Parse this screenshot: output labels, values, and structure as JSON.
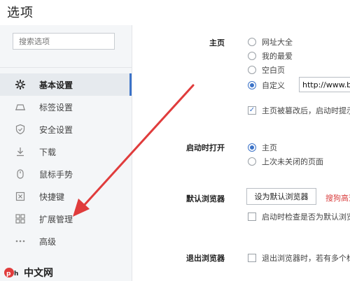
{
  "window": {
    "title": "选项"
  },
  "search": {
    "placeholder": "搜索选项"
  },
  "sidebar": {
    "items": [
      {
        "label": "基本设置",
        "icon": "gear-icon",
        "active": true
      },
      {
        "label": "标签设置",
        "icon": "tab-icon",
        "active": false
      },
      {
        "label": "安全设置",
        "icon": "shield-icon",
        "active": false
      },
      {
        "label": "下载",
        "icon": "download-icon",
        "active": false
      },
      {
        "label": "鼠标手势",
        "icon": "mouse-icon",
        "active": false
      },
      {
        "label": "快捷键",
        "icon": "shortcut-icon",
        "active": false
      },
      {
        "label": "扩展管理",
        "icon": "extensions-icon",
        "active": false
      },
      {
        "label": "高级",
        "icon": "more-icon",
        "active": false
      }
    ]
  },
  "homepage": {
    "label": "主页",
    "options": [
      "网址大全",
      "我的最爱",
      "空白页",
      "自定义"
    ],
    "selected": "自定义",
    "url_value": "http://www.b",
    "tamper_check": {
      "label": "主页被篡改后，启动时提示",
      "checked": true
    }
  },
  "startup": {
    "label": "启动时打开",
    "options": [
      "主页",
      "上次未关闭的页面"
    ],
    "selected": "主页"
  },
  "default_browser": {
    "label": "默认浏览器",
    "button": "设为默认浏览器",
    "link": "搜狗高速",
    "check_label": "启动时检查是否为默认浏览"
  },
  "exit_browser": {
    "label": "退出浏览器",
    "check_label": "退出浏览器时，若有多个标"
  },
  "watermark": {
    "text": "中文网"
  },
  "colors": {
    "accent": "#3c73c8",
    "arrow": "#e03c3c",
    "link": "#d94040"
  }
}
